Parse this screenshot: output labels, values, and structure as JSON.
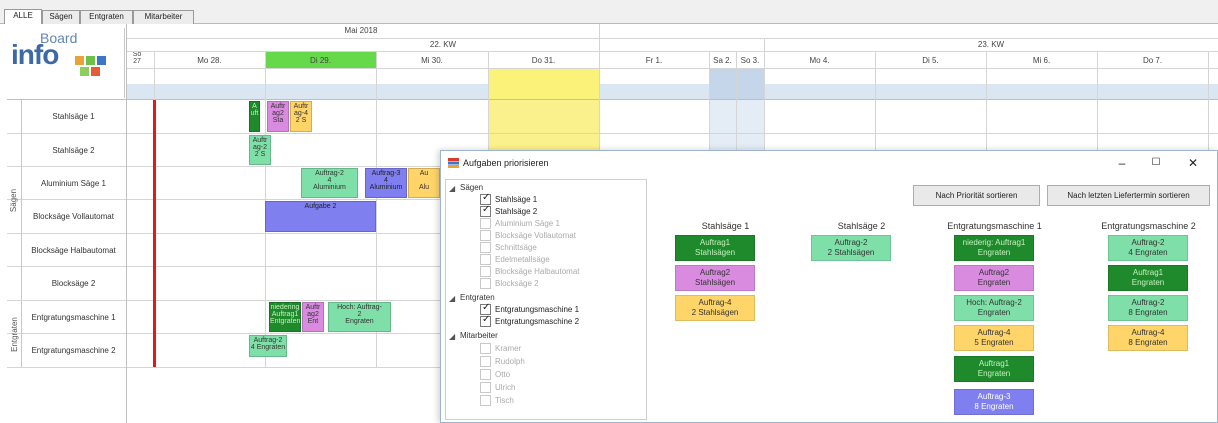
{
  "tabs": [
    {
      "label": "ALLE",
      "active": true
    },
    {
      "label": "Sägen",
      "active": false
    },
    {
      "label": "Entgraten",
      "active": false
    },
    {
      "label": "Mitarbeiter",
      "active": false
    }
  ],
  "logo": {
    "board_text": "Board",
    "info_text": "info"
  },
  "calendar": {
    "month": "Mai 2018",
    "weeks": [
      "22. KW",
      "23. KW"
    ],
    "days": [
      "Mo 28.",
      "Di 29.",
      "Mi 30.",
      "Do 31.",
      "Fr 1.",
      "Sa 2.",
      "So 3.",
      "Mo 4.",
      "Di 5.",
      "Mi 6.",
      "Do 7."
    ],
    "prev_day": "So\n27"
  },
  "groups": [
    {
      "label": "Sägen"
    },
    {
      "label": "Entgraten"
    }
  ],
  "rows": [
    {
      "label": "Stahlsäge 1"
    },
    {
      "label": "Stahlsäge 2"
    },
    {
      "label": "Aluminium Säge 1"
    },
    {
      "label": "Blocksäge Vollautomat"
    },
    {
      "label": "Blocksäge Halbautomat"
    },
    {
      "label": "Blocksäge 2"
    },
    {
      "label": "Entgratungsmaschine 1"
    },
    {
      "label": "Entgratungsmaschine 2"
    }
  ],
  "tasks": [
    {
      "text": "A\nuft",
      "color": "#1e8a2c",
      "fg": "#c7f0c0"
    },
    {
      "text": "Auftr\nag2\nSta",
      "color": "#d98be0",
      "fg": "#333"
    },
    {
      "text": "Auftr\nag-4\n2 S",
      "color": "#ffd56a",
      "fg": "#333"
    },
    {
      "text": "Auftr\nag-2\n2 S",
      "color": "#7ee0a8",
      "fg": "#333"
    },
    {
      "text": "Auftrag-2\n4\nAluminium",
      "color": "#7ee0a8",
      "fg": "#333"
    },
    {
      "text": "Auftrag-3\n4\nAluminium",
      "color": "#7f7ff0",
      "fg": "#222"
    },
    {
      "text": "Au\n\nAlu",
      "color": "#ffd56a",
      "fg": "#333"
    },
    {
      "text": "Aufgabe 2",
      "color": "#7f7ff0",
      "fg": "#222"
    },
    {
      "text": "niedering\nAuftrag1\nEntgraten",
      "color": "#1e8a2c",
      "fg": "#c7f0c0"
    },
    {
      "text": "Auftr\nag2\nEnt",
      "color": "#d98be0",
      "fg": "#333"
    },
    {
      "text": "Hoch: Auftrag-\n2\nEngraten",
      "color": "#7ee0a8",
      "fg": "#333"
    },
    {
      "text": "Auftrag-2\n4 Engraten",
      "color": "#7ee0a8",
      "fg": "#333"
    }
  ],
  "dialog": {
    "title": "Aufgaben priorisieren",
    "controls": {
      "minimize": "–",
      "maximize": "☐",
      "close": "✕"
    },
    "buttons": {
      "sort_priority": "Nach Priorität sortieren",
      "sort_delivery": "Nach letzten Liefertermin sortieren"
    },
    "tree": [
      {
        "text": "Sägen",
        "level": 0
      },
      {
        "text": "Stahlsäge 1",
        "level": 1,
        "checked": true,
        "enabled": true
      },
      {
        "text": "Stahlsäge 2",
        "level": 1,
        "checked": true,
        "enabled": true
      },
      {
        "text": "Aluminium Säge 1",
        "level": 1,
        "checked": false,
        "enabled": false
      },
      {
        "text": "Blocksäge Vollautomat",
        "level": 1,
        "checked": false,
        "enabled": false
      },
      {
        "text": "Schnittsäge",
        "level": 1,
        "checked": false,
        "enabled": false
      },
      {
        "text": "Edelmetallsäge",
        "level": 1,
        "checked": false,
        "enabled": false
      },
      {
        "text": "Blocksäge Halbautomat",
        "level": 1,
        "checked": false,
        "enabled": false
      },
      {
        "text": "Blocksäge 2",
        "level": 1,
        "checked": false,
        "enabled": false
      },
      {
        "text": "Entgraten",
        "level": 0
      },
      {
        "text": "Entgratungsmaschine 1",
        "level": 1,
        "checked": true,
        "enabled": true
      },
      {
        "text": "Entgratungsmaschine 2",
        "level": 1,
        "checked": true,
        "enabled": true
      },
      {
        "text": "Mitarbeiter",
        "level": 0
      },
      {
        "text": "Kramer",
        "level": 1,
        "checked": false,
        "enabled": false
      },
      {
        "text": "Rudolph",
        "level": 1,
        "checked": false,
        "enabled": false
      },
      {
        "text": "Otto",
        "level": 1,
        "checked": false,
        "enabled": false
      },
      {
        "text": "Ulrich",
        "level": 1,
        "checked": false,
        "enabled": false
      },
      {
        "text": "Tisch",
        "level": 1,
        "checked": false,
        "enabled": false
      }
    ],
    "columns": [
      {
        "title": "Stahlsäge 1",
        "cards": [
          {
            "line1": "Auftrag1",
            "line2": "Stahlsägen",
            "color": "#1e8a2c",
            "fg": "#c7f0c0"
          },
          {
            "line1": "Auftrag2",
            "line2": "Stahlsägen",
            "color": "#d98be0",
            "fg": "#333"
          },
          {
            "line1": "Auftrag-4",
            "line2": "2 Stahlsägen",
            "color": "#ffd56a",
            "fg": "#333"
          }
        ]
      },
      {
        "title": "Stahlsäge 2",
        "cards": [
          {
            "line1": "Auftrag-2",
            "line2": "2 Stahlsägen",
            "color": "#7ee0a8",
            "fg": "#333"
          }
        ]
      },
      {
        "title": "Entgratungsmaschine 1",
        "cards": [
          {
            "line1": "niederig: Auftrag1",
            "line2": "Engraten",
            "color": "#1e8a2c",
            "fg": "#c7f0c0"
          },
          {
            "line1": "Auftrag2",
            "line2": "Engraten",
            "color": "#d98be0",
            "fg": "#333"
          },
          {
            "line1": "Hoch: Auftrag-2",
            "line2": "Engraten",
            "color": "#7ee0a8",
            "fg": "#333"
          },
          {
            "line1": "Auftrag-4",
            "line2": "5 Engraten",
            "color": "#ffd56a",
            "fg": "#333"
          },
          {
            "line1": "Auftrag1",
            "line2": "Engraten",
            "color": "#1e8a2c",
            "fg": "#c7f0c0"
          },
          {
            "line1": "Auftrag-3",
            "line2": "8 Engraten",
            "color": "#7f7ff0",
            "fg": "#fff"
          }
        ]
      },
      {
        "title": "Entgratungsmaschine 2",
        "cards": [
          {
            "line1": "Auftrag-2",
            "line2": "4 Engraten",
            "color": "#7ee0a8",
            "fg": "#333"
          },
          {
            "line1": "Auftrag1",
            "line2": "Engraten",
            "color": "#1e8a2c",
            "fg": "#c7f0c0"
          },
          {
            "line1": "Auftrag-2",
            "line2": "8 Engraten",
            "color": "#7ee0a8",
            "fg": "#333"
          },
          {
            "line1": "Auftrag-4",
            "line2": "8 Engraten",
            "color": "#ffd56a",
            "fg": "#333"
          }
        ]
      }
    ]
  }
}
